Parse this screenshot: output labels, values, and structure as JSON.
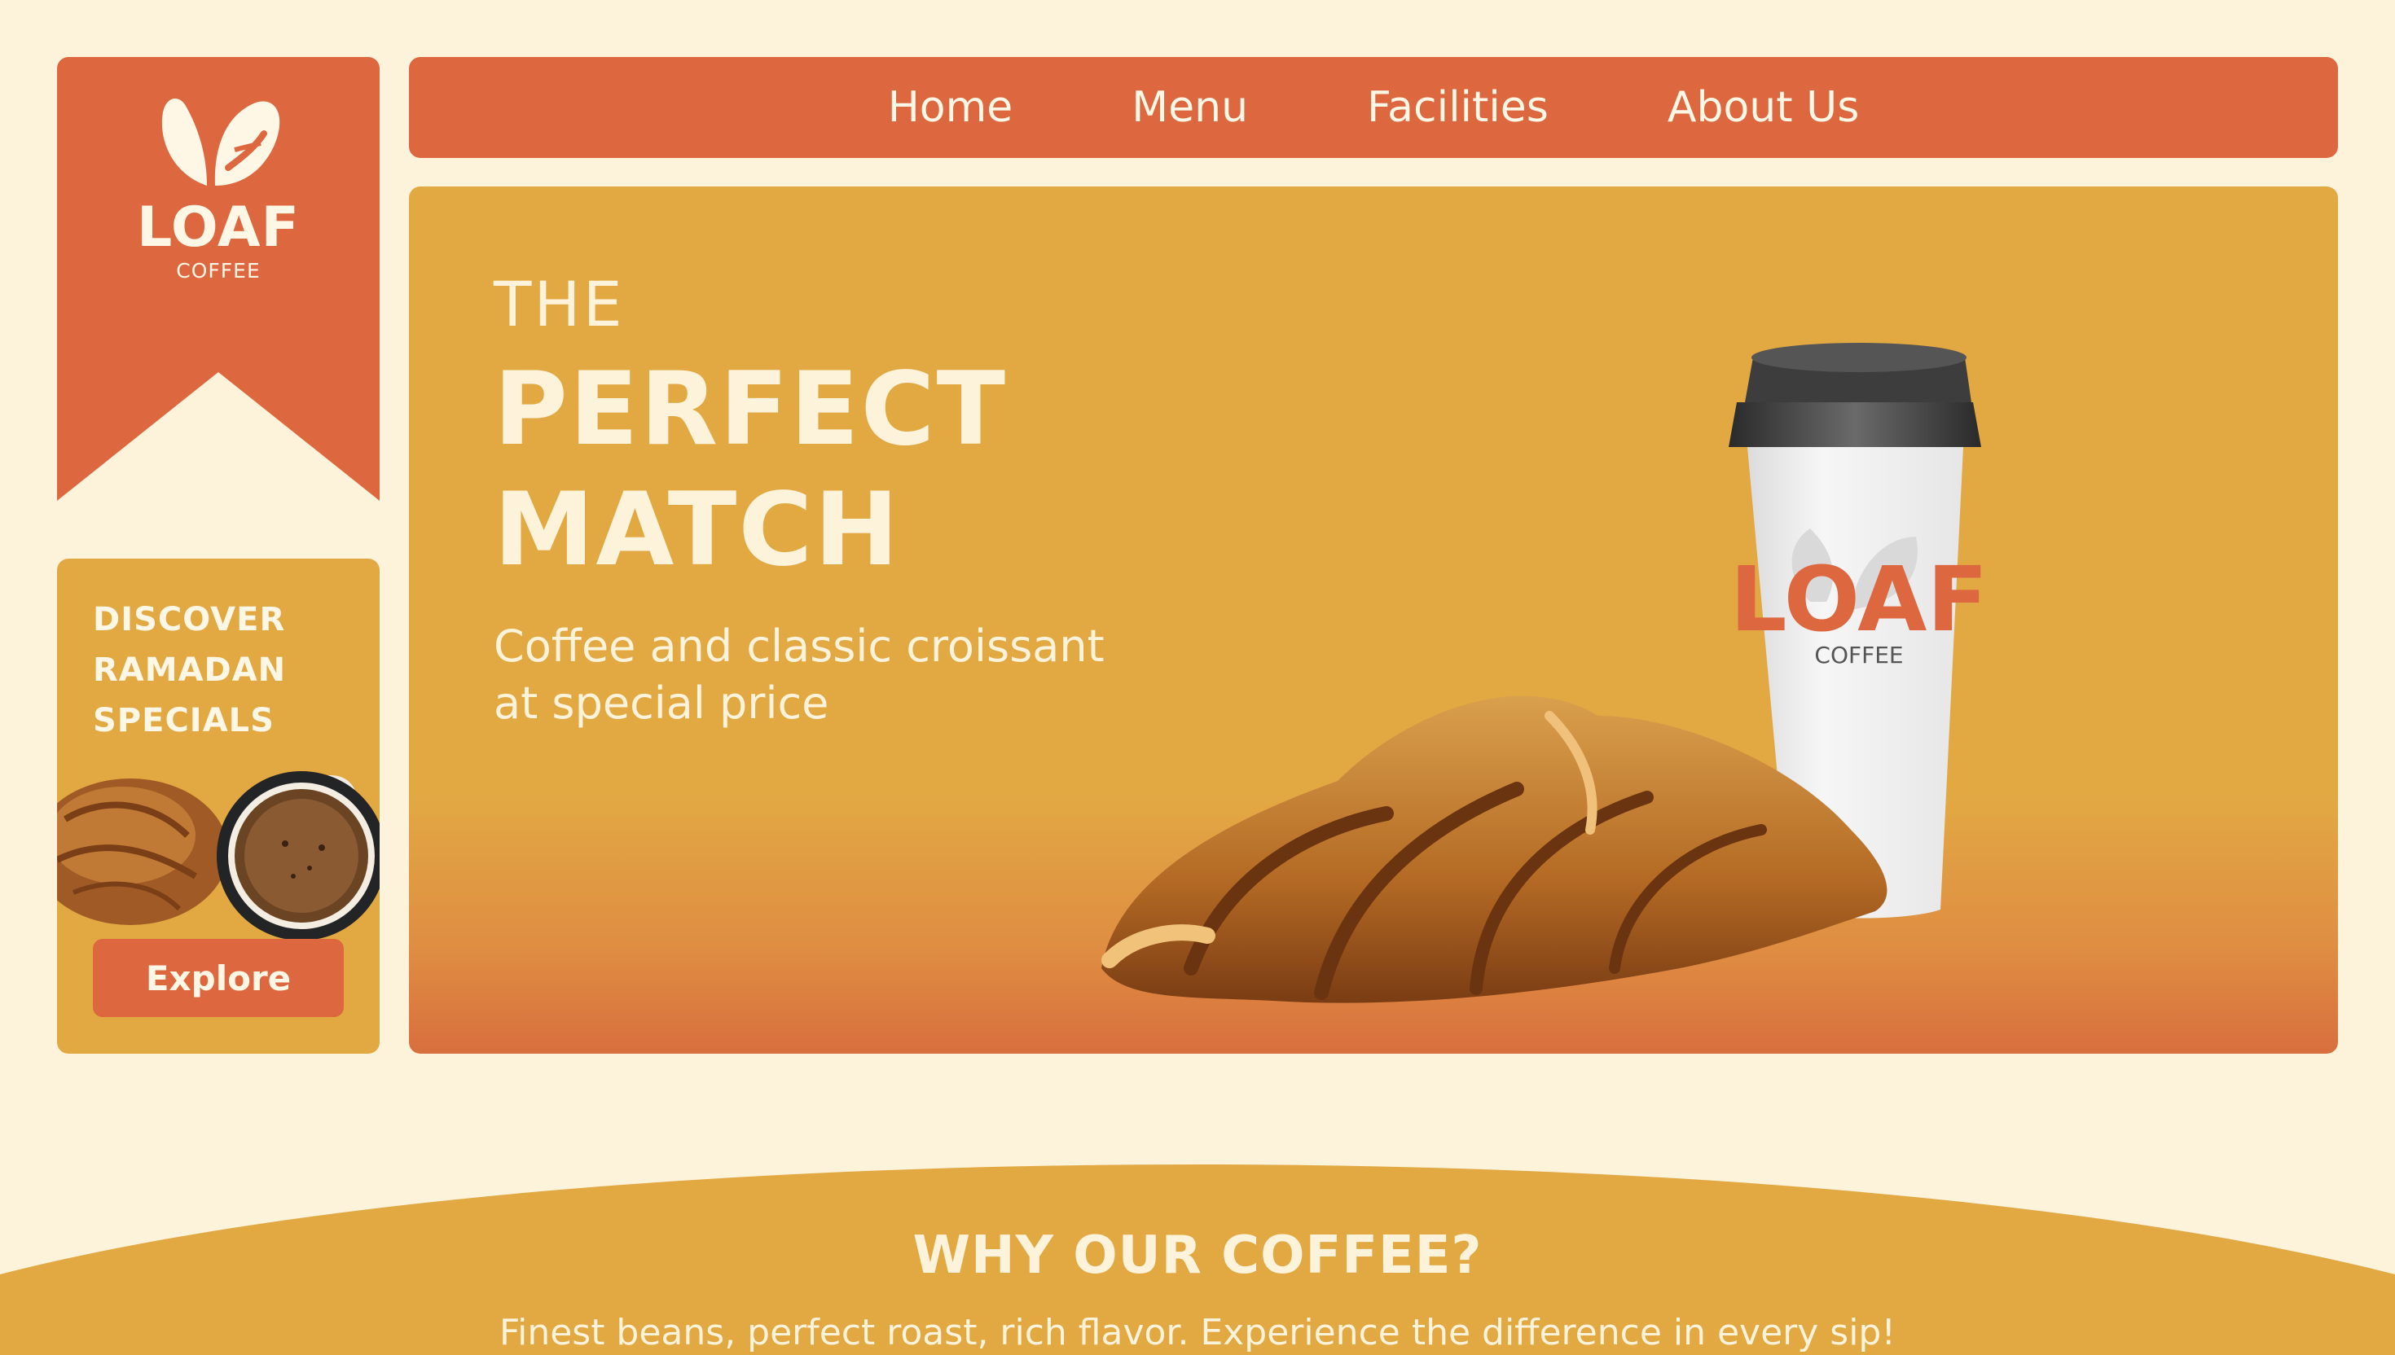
{
  "brand": {
    "name": "LOAF",
    "tagline": "COFFEE"
  },
  "nav": {
    "items": [
      "Home",
      "Menu",
      "Facilities",
      "About Us"
    ]
  },
  "promo": {
    "title_lines": [
      "DISCOVER",
      "RAMADAN",
      "SPECIALS"
    ],
    "button_label": "Explore"
  },
  "hero": {
    "kicker": "THE",
    "headline_lines": [
      "PERFECT",
      "MATCH"
    ],
    "subtitle_lines": [
      "Coffee and classic croissant",
      "at special price"
    ],
    "cup_brand": "LOAF",
    "cup_tagline": "COFFEE"
  },
  "why": {
    "title": "WHY OUR COFFEE?",
    "subtitle": "Finest beans, perfect roast, rich flavor. Experience the difference in every sip!"
  },
  "colors": {
    "background": "#fdf2da",
    "primary": "#dd673e",
    "secondary": "#e2a943",
    "text_light": "#fff7e6"
  }
}
